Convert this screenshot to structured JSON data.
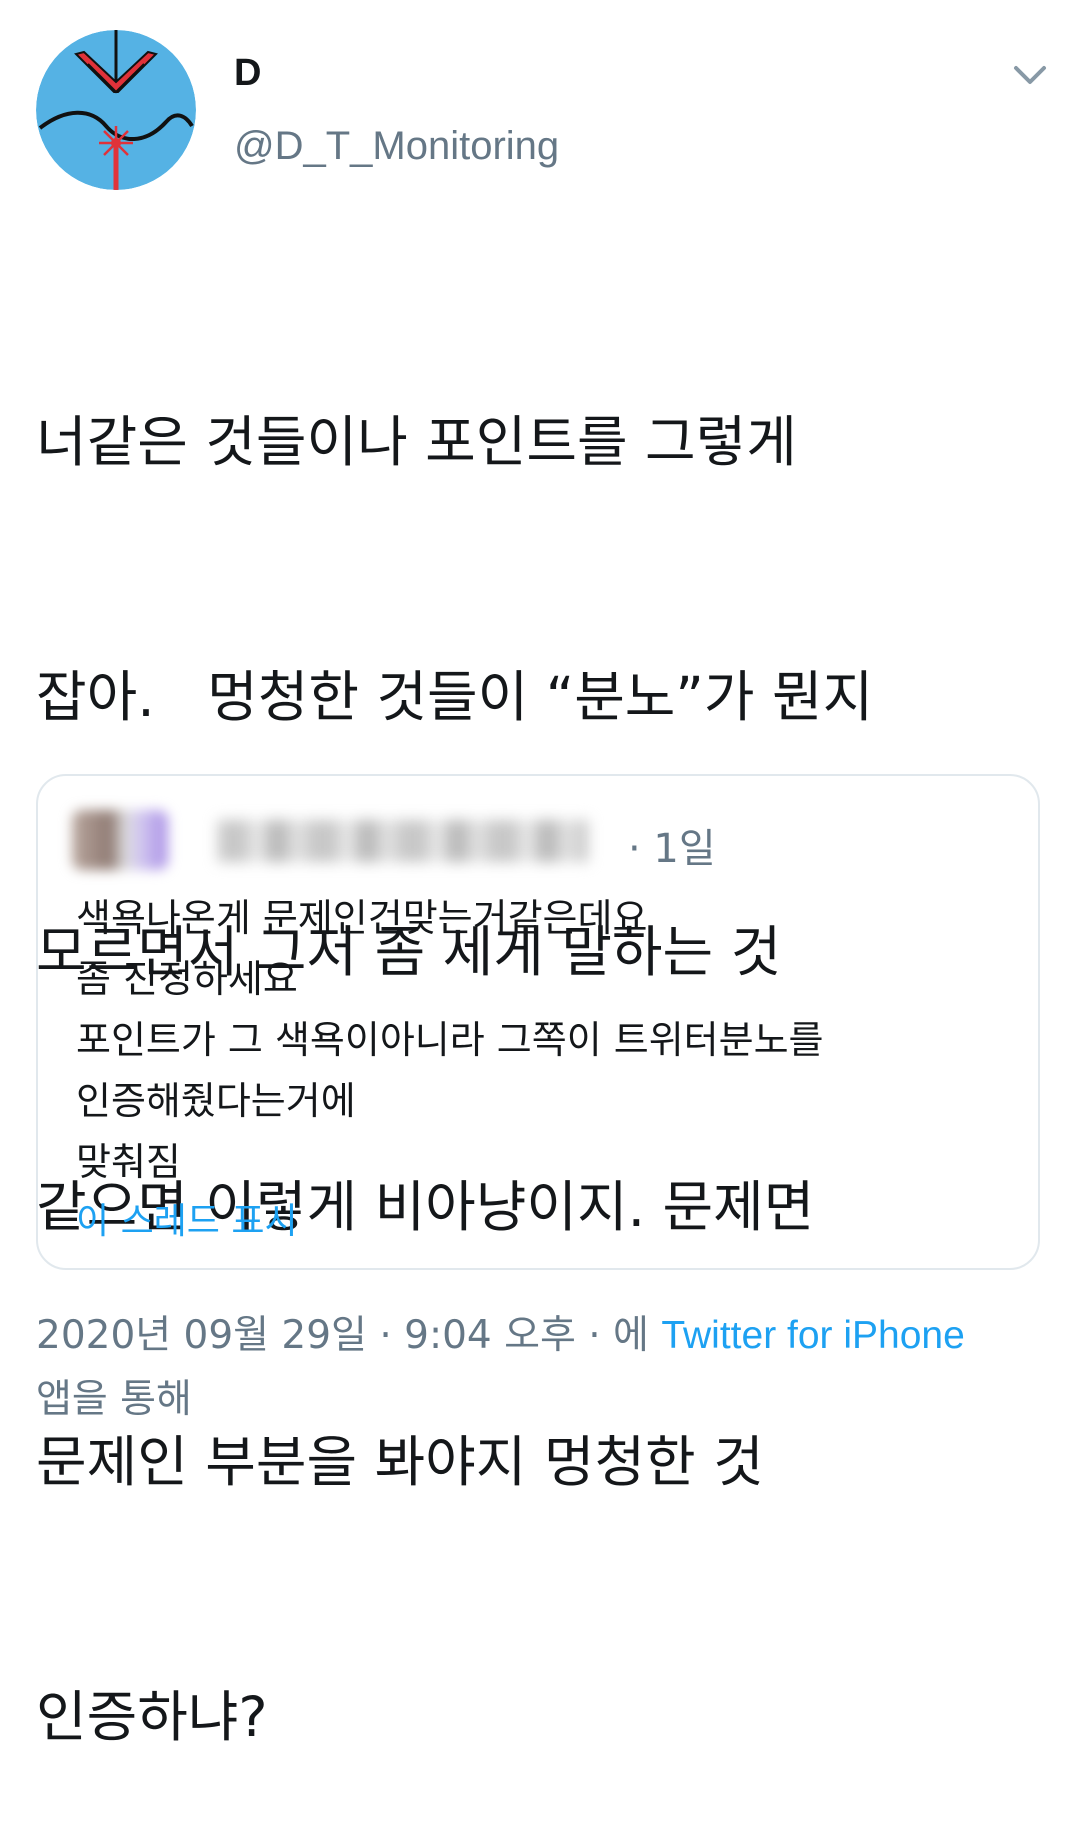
{
  "author": {
    "name": "D",
    "handle": "@D_T_Monitoring"
  },
  "tweet": {
    "lines": [
      "너같은 것들이나 포인트를 그렇게",
      "잡아.   멍청한 것들이 “분노”가 뭔지",
      "모르면서 그저 좀 세게 말하는 것",
      "같으면 이렇게 비아냥이지. 문제면",
      "문제인 부분을 봐야지 멍청한 것",
      "인증하냐?"
    ]
  },
  "quoted_tweet": {
    "time": "· 1일",
    "lines": [
      "색욕나온게 문제인건맞는거같은데요",
      "좀 진정하세요",
      "포인트가 그 색욕이아니라 그쪽이 트위터분노를",
      "인증해줬다는거에",
      "맞춰짐"
    ],
    "show_thread": "이 스레드 표시"
  },
  "meta": {
    "timestamp": "2020년 09월 29일 · 9:04 오후 · 에 ",
    "source": "Twitter for iPhone",
    "suffix": "앱을 통해"
  },
  "colors": {
    "link": "#1da1f2",
    "secondary_text": "#657786",
    "avatar_bg": "#55b2e4",
    "avatar_accent": "#e0323a"
  },
  "icons": {
    "menu": "chevron-down-icon",
    "avatar": "logo-avatar"
  }
}
